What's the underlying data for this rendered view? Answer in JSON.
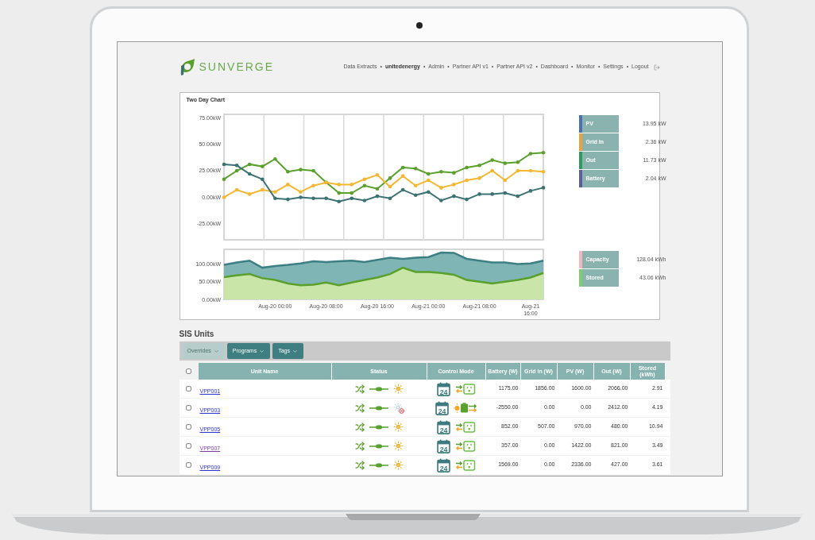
{
  "logo": {
    "text": "SUNVERGE"
  },
  "nav": {
    "separator": "•",
    "items": [
      {
        "label": "Data Extracts",
        "selected": false
      },
      {
        "label": "unitedenergy",
        "selected": true
      },
      {
        "label": "Admin",
        "selected": false
      },
      {
        "label": "Partner API v1",
        "selected": false
      },
      {
        "label": "Partner API v2",
        "selected": false
      },
      {
        "label": "Dashboard",
        "selected": false
      },
      {
        "label": "Monitor",
        "selected": false
      },
      {
        "label": "Settings",
        "selected": false
      },
      {
        "label": "Logout",
        "selected": false
      }
    ]
  },
  "chart_panel": {
    "title": "Two Day Chart",
    "power_chart": {
      "chart_data": {
        "type": "line",
        "categories": [
          null,
          null,
          null,
          null,
          null,
          null,
          null,
          null,
          null,
          null,
          null,
          null,
          null,
          null,
          null,
          null,
          null,
          null,
          null,
          null,
          null,
          null,
          null,
          null,
          null,
          null
        ],
        "ylim": [
          -40,
          78
        ],
        "yticks": [
          {
            "value": 75,
            "label": "75.00kW"
          },
          {
            "value": 50,
            "label": "50.00kW"
          },
          {
            "value": 25,
            "label": "25.00kW"
          },
          {
            "value": 0,
            "label": "0.00kW"
          },
          {
            "value": -25,
            "label": "-25.00kW"
          }
        ],
        "series": [
          {
            "color": "#5aa02c",
            "values": [
              17,
              25,
              31,
              29,
              36,
              24,
              26,
              25,
              14,
              4,
              4,
              11,
              8,
              18,
              28,
              27,
              22,
              24,
              23,
              28,
              30,
              35,
              32,
              33,
              41,
              42
            ]
          },
          {
            "color": "#f5b731",
            "values": [
              0,
              7,
              3,
              7,
              5,
              12,
              5,
              11,
              14,
              12,
              12,
              17,
              21,
              10,
              20,
              11,
              16,
              9,
              12,
              16,
              18,
              25,
              16,
              25,
              25,
              24
            ]
          },
          {
            "color": "#3d7274",
            "values": [
              31,
              30,
              22,
              17,
              -1,
              -2,
              0,
              -1,
              -1,
              -4,
              -1,
              -3,
              1,
              -1,
              7,
              2,
              5,
              -3,
              1,
              -2,
              3,
              3,
              4,
              1,
              6,
              9
            ]
          }
        ]
      }
    },
    "energy_chart": {
      "chart_data": {
        "type": "area",
        "categories": [
          null,
          null,
          null,
          null,
          "Aug-20 00:00",
          null,
          null,
          null,
          "Aug-20 08:00",
          null,
          null,
          null,
          "Aug-20 16:00",
          null,
          null,
          null,
          "Aug-21 00:00",
          null,
          null,
          null,
          "Aug-21 08:00",
          null,
          null,
          null,
          "Aug-21 16:00",
          null
        ],
        "ylim": [
          0,
          142
        ],
        "yticks": [
          {
            "value": 100,
            "label": "100.00kW"
          },
          {
            "value": 50,
            "label": "50.00kW"
          },
          {
            "value": 0,
            "label": "0.00kW"
          }
        ],
        "series": [
          {
            "color": "#3e7f84",
            "values": [
              98,
              105,
              110,
              90,
              95,
              98,
              102,
              108,
              106,
              108,
              110,
              106,
              112,
              118,
              115,
              118,
              120,
              133,
              132,
              115,
              110,
              105,
              105,
              100,
              102,
              110
            ]
          },
          {
            "color": "#5aa02c",
            "values": [
              63,
              68,
              72,
              60,
              55,
              45,
              40,
              42,
              48,
              40,
              48,
              55,
              62,
              72,
              90,
              78,
              78,
              75,
              70,
              55,
              50,
              45,
              50,
              55,
              62,
              75
            ]
          }
        ]
      }
    },
    "power_legend": [
      {
        "label": "PV",
        "value": "13.95 kW",
        "color": "#4a6fb5"
      },
      {
        "label": "Grid In",
        "value": "2.36 kW",
        "color": "#e9a23b"
      },
      {
        "label": "Out",
        "value": "11.73 kW",
        "color": "#2f9a5e"
      },
      {
        "label": "Battery",
        "value": "2.04 kW",
        "color": "#5d5a9e"
      }
    ],
    "energy_legend": [
      {
        "label": "Capacity",
        "value": "128.04 kWh",
        "color": "#f2b8c0"
      },
      {
        "label": "Stored",
        "value": "43.06 kWh",
        "color": "#7ccf6e"
      }
    ]
  },
  "units": {
    "title": "SIS Units",
    "toolbar": [
      {
        "label": "Overrides",
        "disabled": true
      },
      {
        "label": "Programs",
        "disabled": false
      },
      {
        "label": "Tags",
        "disabled": false
      }
    ],
    "table": {
      "header_checked": false,
      "columns": [
        "Unit Name",
        "Status",
        "Control Mode",
        "Battery (W)",
        "Grid In (W)",
        "PV (W)",
        "Out (W)",
        "Stored (kWh)"
      ],
      "rows": [
        {
          "checked": false,
          "unit": "VPP001",
          "visited": false,
          "solar_fault": false,
          "calendar": "24",
          "mode": {
            "kind": "outlet"
          },
          "battery": "1175.00",
          "grid_in": "1856.00",
          "pv": "1600.00",
          "out": "2066.00",
          "stored": "2.91"
        },
        {
          "checked": false,
          "unit": "VPP003",
          "visited": false,
          "solar_fault": true,
          "calendar": "24",
          "mode": {
            "kind": "battery"
          },
          "battery": "-2550.00",
          "grid_in": "0.00",
          "pv": "0.00",
          "out": "2412.00",
          "stored": "4.19"
        },
        {
          "checked": false,
          "unit": "VPP005",
          "visited": false,
          "solar_fault": false,
          "calendar": "24",
          "mode": {
            "kind": "outlet"
          },
          "battery": "852.00",
          "grid_in": "507.00",
          "pv": "970.00",
          "out": "480.00",
          "stored": "10.94"
        },
        {
          "checked": false,
          "unit": "VPP007",
          "visited": true,
          "solar_fault": false,
          "calendar": "24",
          "mode": {
            "kind": "outlet"
          },
          "battery": "357.00",
          "grid_in": "0.00",
          "pv": "1422.00",
          "out": "821.00",
          "stored": "3.49"
        },
        {
          "checked": false,
          "unit": "VPP009",
          "visited": false,
          "solar_fault": false,
          "calendar": "24",
          "mode": {
            "kind": "outlet"
          },
          "battery": "1569.00",
          "grid_in": "0.00",
          "pv": "2336.00",
          "out": "427.00",
          "stored": "3.61"
        }
      ]
    }
  }
}
